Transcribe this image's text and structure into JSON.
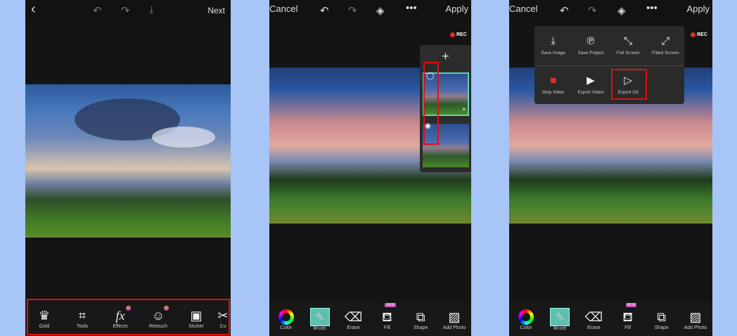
{
  "screen1": {
    "back_icon": "chevron-left",
    "next": "Next",
    "tools": [
      {
        "label": "Gold",
        "icon": "crown"
      },
      {
        "label": "Tools",
        "icon": "crop"
      },
      {
        "label": "Effects",
        "icon": "fx"
      },
      {
        "label": "Retouch",
        "icon": "face"
      },
      {
        "label": "Sticker",
        "icon": "sticker"
      },
      {
        "label": "Cu",
        "icon": "cutout"
      }
    ]
  },
  "screen2": {
    "cancel": "Cancel",
    "apply": "Apply",
    "rec": "REC",
    "add_layer": "+",
    "tools": [
      {
        "label": "Color"
      },
      {
        "label": "Brush"
      },
      {
        "label": "Erase"
      },
      {
        "label": "Fill",
        "badge": "NEW"
      },
      {
        "label": "Shape"
      },
      {
        "label": "Add Photo"
      }
    ]
  },
  "screen3": {
    "cancel": "Cancel",
    "apply": "Apply",
    "rec": "REC",
    "menu": [
      {
        "label": "Save Image",
        "icon": "download"
      },
      {
        "label": "Save Project",
        "icon": "picsart"
      },
      {
        "label": "Full Screen",
        "icon": "expand"
      },
      {
        "label": "Fitted Screen",
        "icon": "diagonal-expand"
      },
      {
        "label": "Stop Video",
        "icon": "video-record"
      },
      {
        "label": "Export Video",
        "icon": "video-play"
      },
      {
        "label": "Export Gif",
        "icon": "file-gif"
      }
    ],
    "tools": [
      {
        "label": "Color"
      },
      {
        "label": "Brush"
      },
      {
        "label": "Erase"
      },
      {
        "label": "Fill",
        "badge": "NEW"
      },
      {
        "label": "Shape"
      },
      {
        "label": "Add Photo"
      }
    ]
  },
  "colors": {
    "background": "#a8c5f7",
    "highlight": "#e01010",
    "accent": "#5ebfae"
  }
}
